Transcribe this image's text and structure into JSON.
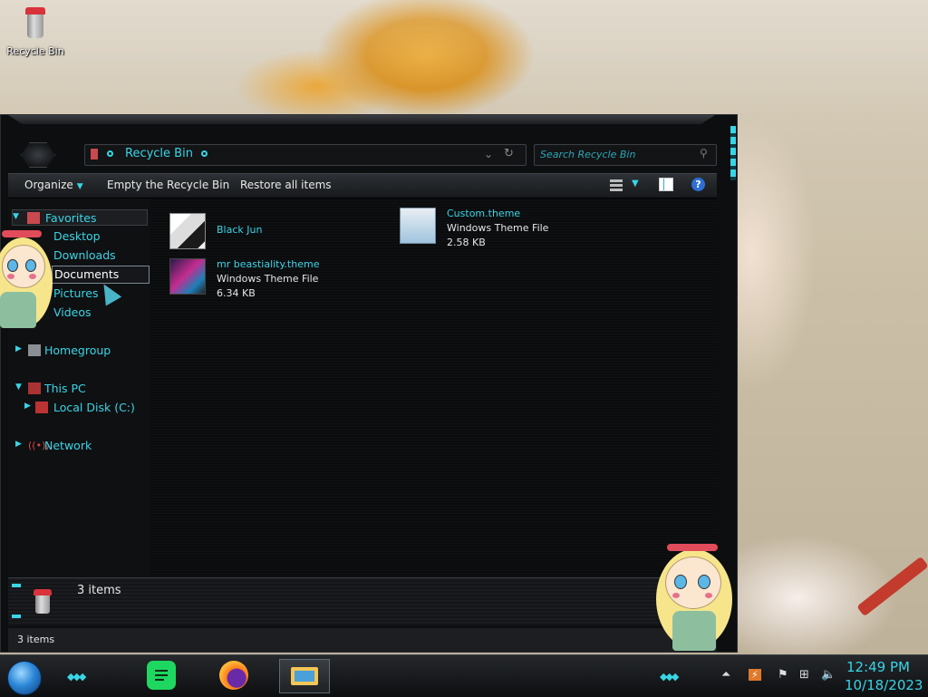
{
  "desktop": {
    "icons": [
      {
        "label": "Recycle Bin",
        "icon": "recycle-bin-icon"
      }
    ]
  },
  "window": {
    "address": {
      "path": "Recycle Bin"
    },
    "search": {
      "placeholder": "Search Recycle Bin"
    },
    "toolbar": {
      "organize": "Organize",
      "empty": "Empty the Recycle Bin",
      "restore": "Restore all items"
    },
    "nav": {
      "favorites": "Favorites",
      "favorites_items": [
        "Desktop",
        "Downloads",
        "Documents",
        "Pictures",
        "Videos"
      ],
      "homegroup": "Homegroup",
      "this_pc": "This PC",
      "local_disk": "Local Disk (C:)",
      "network": "Network"
    },
    "files": [
      {
        "name": "Black Jun",
        "type": "",
        "size": ""
      },
      {
        "name": "Custom.theme",
        "type": "Windows Theme File",
        "size": "2.58 KB"
      },
      {
        "name": "mr beastiality.theme",
        "type": "Windows Theme File",
        "size": "6.34 KB"
      }
    ],
    "details": {
      "count": "3 items"
    },
    "status": {
      "count": "3 items"
    }
  },
  "taskbar": {
    "apps": [
      "Spotify",
      "Firefox",
      "File Explorer"
    ],
    "clock": {
      "time": "12:49 PM",
      "date": "10/18/2023"
    }
  },
  "colors": {
    "accent": "#39d5e6",
    "window_bg": "#0d0e10",
    "text": "#e6e6e6"
  }
}
